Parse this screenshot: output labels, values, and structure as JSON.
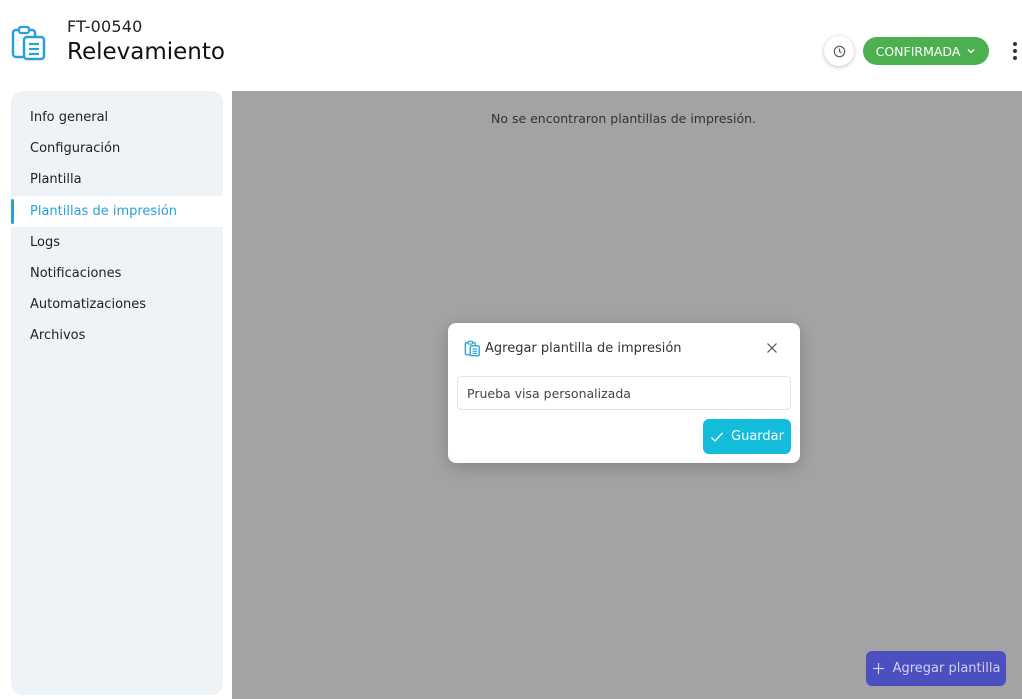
{
  "header": {
    "code": "FT-00540",
    "title": "Relevamiento",
    "icon": "clipboard-document-icon",
    "history_icon": "clock-icon",
    "status_label": "CONFIRMADA",
    "status_color": "#4caf50",
    "more_icon": "kebab-menu-icon"
  },
  "sidebar": {
    "items": [
      {
        "label": "Info general",
        "active": false
      },
      {
        "label": "Configuración",
        "active": false
      },
      {
        "label": "Plantilla",
        "active": false
      },
      {
        "label": "Plantillas de impresión",
        "active": true
      },
      {
        "label": "Logs",
        "active": false
      },
      {
        "label": "Notificaciones",
        "active": false
      },
      {
        "label": "Automatizaciones",
        "active": false
      },
      {
        "label": "Archivos",
        "active": false
      }
    ],
    "accent_color": "#2aa0d8"
  },
  "main": {
    "empty_message": "No se encontraron plantillas de impresión.",
    "add_button_label": "Agregar plantilla"
  },
  "modal": {
    "title": "Agregar plantilla de impresión",
    "input_value": "Prueba visa personalizada",
    "save_label": "Guardar",
    "save_color": "#14bcdc"
  }
}
